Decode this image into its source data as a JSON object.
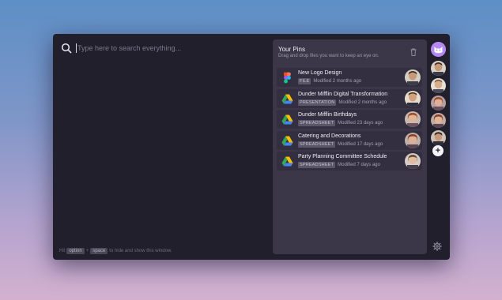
{
  "search": {
    "placeholder": "Type here to search everything..."
  },
  "hint": {
    "prefix": "Hit",
    "key1": "option",
    "plus": "+",
    "key2": "space",
    "suffix": "to hide and show this window."
  },
  "pins": {
    "title": "Your Pins",
    "subtitle": "Drag and drop files you want to keep an eye on.",
    "items": [
      {
        "title": "New Logo Design",
        "type": "FILE",
        "modified": "Modified 2 months ago",
        "app_icon": "figma-icon"
      },
      {
        "title": "Dunder Mifflin Digital Transformation",
        "type": "PRESENTATION",
        "modified": "Modified 2 months ago",
        "app_icon": "google-drive-icon"
      },
      {
        "title": "Dunder Mifflin Birthdays",
        "type": "SPREADSHEET",
        "modified": "Modified 23 days ago",
        "app_icon": "google-drive-icon"
      },
      {
        "title": "Catering and Decorations",
        "type": "SPREADSHEET",
        "modified": "Modified 17 days ago",
        "app_icon": "google-drive-icon"
      },
      {
        "title": "Party Planning Committee Schedule",
        "type": "SPREADSHEET",
        "modified": "Modified 7 days ago",
        "app_icon": "google-drive-icon"
      }
    ]
  },
  "rail": {
    "add_label": "+"
  },
  "colors": {
    "accent": "#b48af0",
    "window_bg": "#221f2c",
    "panel_bg": "#3b3748",
    "row_bg": "#332f40"
  }
}
